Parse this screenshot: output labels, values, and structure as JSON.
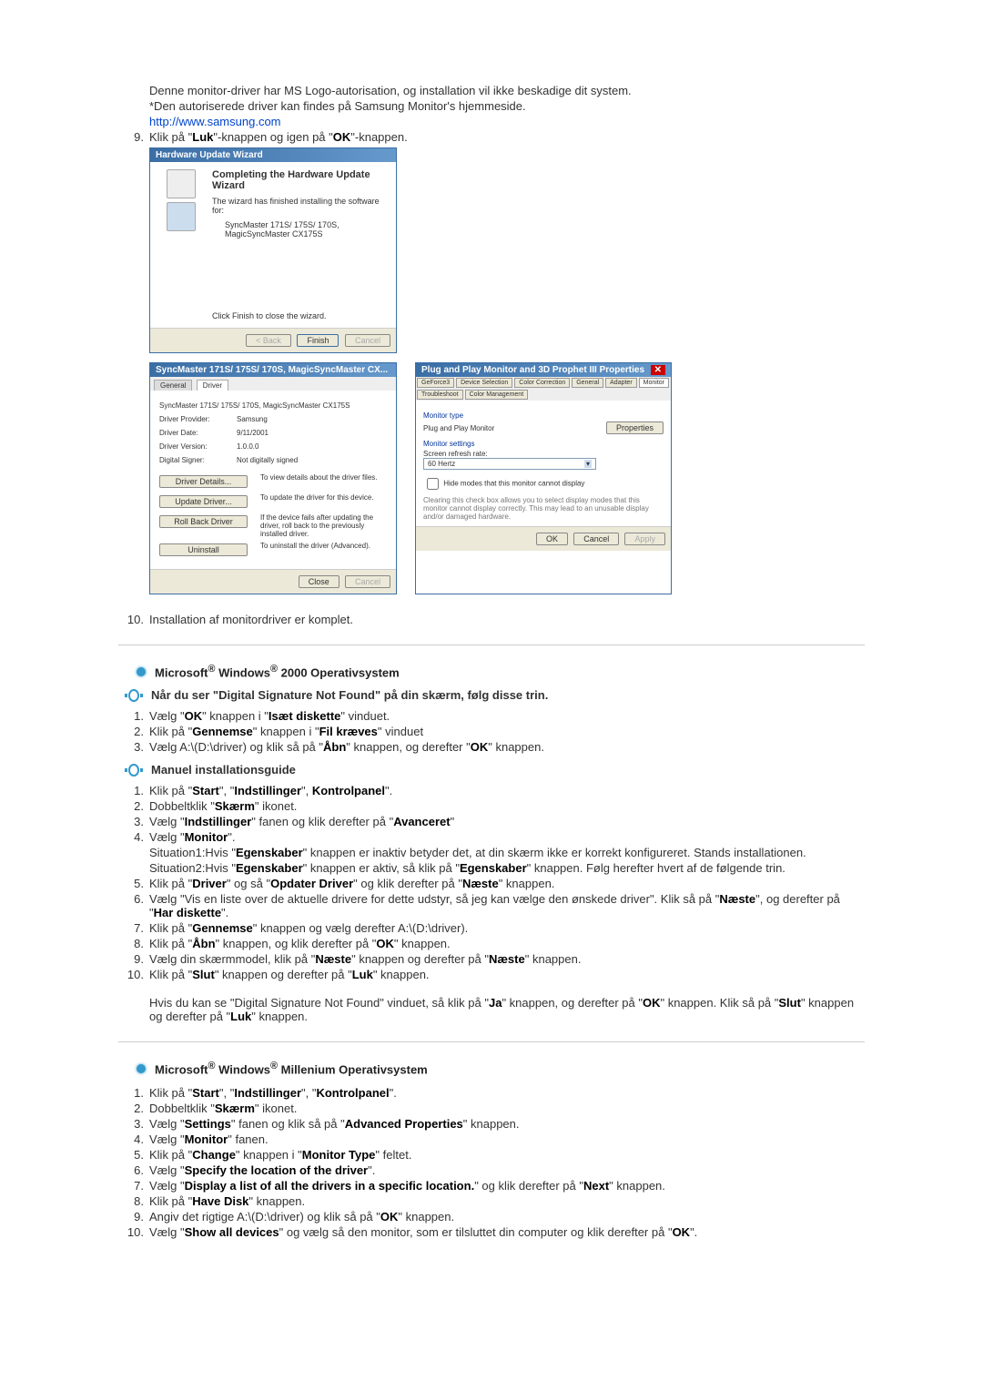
{
  "intro": {
    "line1a": "Denne monitor-driver har MS Logo-autorisation, og installation vil ikke beskadige dit system.",
    "line1b": "*Den autoriserede driver kan findes på Samsung Monitor's hjemmeside.",
    "link": "http://www.samsung.com",
    "step9_num": "9.",
    "step9_a": "Klik på \"",
    "step9_b": "Luk",
    "step9_c": "\"-knappen og igen på \"",
    "step9_d": "OK",
    "step9_e": "\"-knappen."
  },
  "wizard": {
    "title": "Hardware Update Wizard",
    "heading": "Completing the Hardware Update Wizard",
    "line1": "The wizard has finished installing the software for:",
    "line2": "SyncMaster 171S/ 175S/ 170S, MagicSyncMaster CX175S",
    "finish_hint": "Click Finish to close the wizard.",
    "back": "< Back",
    "finish": "Finish",
    "cancel": "Cancel"
  },
  "dialog2": {
    "title": "SyncMaster 171S/ 175S/ 170S, MagicSyncMaster CX...",
    "tab_general": "General",
    "tab_driver": "Driver",
    "device": "SyncMaster 171S/ 175S/ 170S, MagicSyncMaster CX175S",
    "provider_label": "Driver Provider:",
    "provider": "Samsung",
    "date_label": "Driver Date:",
    "date": "9/11/2001",
    "version_label": "Driver Version:",
    "version": "1.0.0.0",
    "signer_label": "Digital Signer:",
    "signer": "Not digitally signed",
    "btn_details": "Driver Details...",
    "btn_details_desc": "To view details about the driver files.",
    "btn_update": "Update Driver...",
    "btn_update_desc": "To update the driver for this device.",
    "btn_rollback": "Roll Back Driver",
    "btn_rollback_desc": "If the device fails after updating the driver, roll back to the previously installed driver.",
    "btn_uninstall": "Uninstall",
    "btn_uninstall_desc": "To uninstall the driver (Advanced).",
    "close": "Close",
    "cancel": "Cancel"
  },
  "dialog3": {
    "title": "Plug and Play Monitor and 3D Prophet III Properties",
    "tabs": {
      "geforce": "GeForce3",
      "device_sel": "Device Selection",
      "color_corr": "Color Correction",
      "general": "General",
      "adapter": "Adapter",
      "monitor": "Monitor",
      "troubleshoot": "Troubleshoot",
      "color_mgmt": "Color Management"
    },
    "monitor_type_label": "Monitor type",
    "monitor_type": "Plug and Play Monitor",
    "properties": "Properties",
    "settings_label": "Monitor settings",
    "refresh_label": "Screen refresh rate:",
    "refresh_value": "60 Hertz",
    "hide_check": "Hide modes that this monitor cannot display",
    "hide_desc": "Clearing this check box allows you to select display modes that this monitor cannot display correctly. This may lead to an unusable display and/or damaged hardware.",
    "ok": "OK",
    "cancel": "Cancel",
    "apply": "Apply"
  },
  "step10": {
    "num": "10.",
    "text": "Installation af monitordriver er komplet."
  },
  "win2000": {
    "heading_a": "Microsoft",
    "heading_b": " Windows",
    "heading_c": " 2000 Operativsystem",
    "sig_heading": "Når du ser \"Digital Signature Not Found\" på din skærm, følg disse trin.",
    "s1": {
      "n": "1.",
      "a": "Vælg \"",
      "b": "OK",
      "c": "\" knappen i \"",
      "d": "Isæt diskette",
      "e": "\" vinduet."
    },
    "s2": {
      "n": "2.",
      "a": "Klik på \"",
      "b": "Gennemse",
      "c": "\" knappen i \"",
      "d": "Fil kræves",
      "e": "\" vinduet"
    },
    "s3": {
      "n": "3.",
      "a": "Vælg A:\\(D:\\driver) og klik så på \"",
      "b": "Åbn",
      "c": "\" knappen, og derefter \"",
      "d": "OK",
      "e": "\" knappen."
    },
    "manual_heading": "Manuel installationsguide",
    "m1": {
      "n": "1.",
      "a": "Klik på \"",
      "b": "Start",
      "c": "\", \"",
      "d": "Indstillinger",
      "e": "\", ",
      "f": "Kontrolpanel",
      "g": "\"."
    },
    "m2": {
      "n": "2.",
      "a": "Dobbeltklik \"",
      "b": "Skærm",
      "c": "\" ikonet."
    },
    "m3": {
      "n": "3.",
      "a": "Vælg \"",
      "b": "Indstillinger",
      "c": "\" fanen og klik derefter på \"",
      "d": "Avanceret",
      "e": "\""
    },
    "m4": {
      "n": "4.",
      "a": "Vælg \"",
      "b": "Monitor",
      "c": "\".",
      "sit1a": "Situation1:Hvis \"",
      "sit1b": "Egenskaber",
      "sit1c": "\" knappen er inaktiv betyder det, at din skærm ikke er korrekt konfigureret. Stands installationen.",
      "sit2a": "Situation2:Hvis \"",
      "sit2b": "Egenskaber",
      "sit2c": "\" knappen er aktiv, så klik på \"",
      "sit2d": "Egenskaber",
      "sit2e": "\" knappen. Følg herefter hvert af de følgende trin."
    },
    "m5": {
      "n": "5.",
      "a": "Klik på \"",
      "b": "Driver",
      "c": "\" og så \"",
      "d": "Opdater Driver",
      "e": "\" og klik derefter på \"",
      "f": "Næste",
      "g": "\" knappen."
    },
    "m6": {
      "n": "6.",
      "a": "Vælg \"Vis en liste over de aktuelle drivere for dette udstyr, så jeg kan vælge den ønskede driver\". Klik så på \"",
      "b": "Næste",
      "c": "\", og derefter på \"",
      "d": "Har diskette",
      "e": "\"."
    },
    "m7": {
      "n": "7.",
      "a": "Klik på \"",
      "b": "Gennemse",
      "c": "\" knappen og vælg derefter A:\\(D:\\driver)."
    },
    "m8": {
      "n": "8.",
      "a": "Klik på \"",
      "b": "Åbn",
      "c": "\" knappen, og klik derefter på \"",
      "d": "OK",
      "e": "\" knappen."
    },
    "m9": {
      "n": "9.",
      "a": "Vælg din skærmmodel, klik på \"",
      "b": "Næste",
      "c": "\" knappen og derefter på \"",
      "d": "Næste",
      "e": "\" knappen."
    },
    "m10": {
      "n": "10.",
      "a": "Klik på \"",
      "b": "Slut",
      "c": "\" knappen og derefter på \"",
      "d": "Luk",
      "e": "\" knappen."
    },
    "note_a": "Hvis du kan se \"Digital Signature Not Found\" vinduet, så klik på \"",
    "note_b": "Ja",
    "note_c": "\" knappen, og derefter på \"",
    "note_d": "OK",
    "note_e": "\" knappen. Klik så på \"",
    "note_f": "Slut",
    "note_g": "\" knappen og derefter på \"",
    "note_h": "Luk",
    "note_i": "\" knappen."
  },
  "winme": {
    "heading_a": "Microsoft",
    "heading_b": " Windows",
    "heading_c": " Millenium Operativsystem",
    "s1": {
      "n": "1.",
      "a": "Klik på \"",
      "b": "Start",
      "c": "\", \"",
      "d": "Indstillinger",
      "e": "\", \"",
      "f": "Kontrolpanel",
      "g": "\"."
    },
    "s2": {
      "n": "2.",
      "a": "Dobbeltklik \"",
      "b": "Skærm",
      "c": "\" ikonet."
    },
    "s3": {
      "n": "3.",
      "a": "Vælg \"",
      "b": "Settings",
      "c": "\" fanen og klik så på \"",
      "d": "Advanced Properties",
      "e": "\" knappen."
    },
    "s4": {
      "n": "4.",
      "a": "Vælg \"",
      "b": "Monitor",
      "c": "\" fanen."
    },
    "s5": {
      "n": "5.",
      "a": "Klik på \"",
      "b": "Change",
      "c": "\" knappen i \"",
      "d": "Monitor Type",
      "e": "\" feltet."
    },
    "s6": {
      "n": "6.",
      "a": "Vælg \"",
      "b": "Specify the location of the driver",
      "c": "\"."
    },
    "s7": {
      "n": "7.",
      "a": "Vælg \"",
      "b": "Display a list of all the drivers in a specific location.",
      "c": "\" og klik derefter på \"",
      "d": "Next",
      "e": "\" knappen."
    },
    "s8": {
      "n": "8.",
      "a": "Klik på \"",
      "b": "Have Disk",
      "c": "\" knappen."
    },
    "s9": {
      "n": "9.",
      "a": "Angiv det rigtige A:\\(D:\\driver) og klik så på \"",
      "b": "OK",
      "c": "\" knappen."
    },
    "s10": {
      "n": "10.",
      "a": "Vælg \"",
      "b": "Show all devices",
      "c": "\" og vælg så den monitor, som er tilsluttet din computer og klik derefter på \"",
      "d": "OK",
      "e": "\"."
    }
  }
}
